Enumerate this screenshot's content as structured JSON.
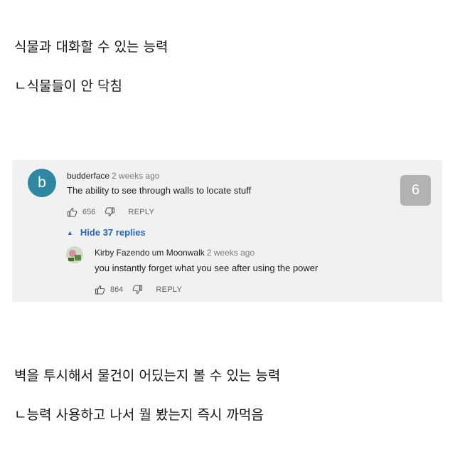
{
  "post": {
    "line1": "식물과 대화할 수 있는 능력",
    "line2": "ㄴ식물들이 안 닥침",
    "line3": "벽을 투시해서 물건이 어딨는지 볼 수 있는 능력",
    "line4": "ㄴ능력 사용하고 나서 뭘 봤는지 즉시 까먹음"
  },
  "comment": {
    "avatar_letter": "b",
    "author": "budderface",
    "time": "2 weeks ago",
    "text": "The ability to see through walls to locate stuff",
    "likes": "656",
    "reply_label": "REPLY",
    "hide_replies": "Hide 37 replies",
    "hide_caret": "▲"
  },
  "reply": {
    "author": "Kirby Fazendo um Moonwalk",
    "time": "2 weeks ago",
    "text": "you instantly forget what you see after using the power",
    "likes": "864",
    "reply_label": "REPLY"
  },
  "badge": {
    "number": "6"
  },
  "icons": {
    "like": "thumbs-up-icon",
    "dislike": "thumbs-down-icon",
    "caret": "caret-up-icon"
  },
  "colors": {
    "avatar": "#2f87a2",
    "link": "#2a65b8",
    "panel": "#f1f1f1",
    "badge": "#b2b2b2"
  }
}
